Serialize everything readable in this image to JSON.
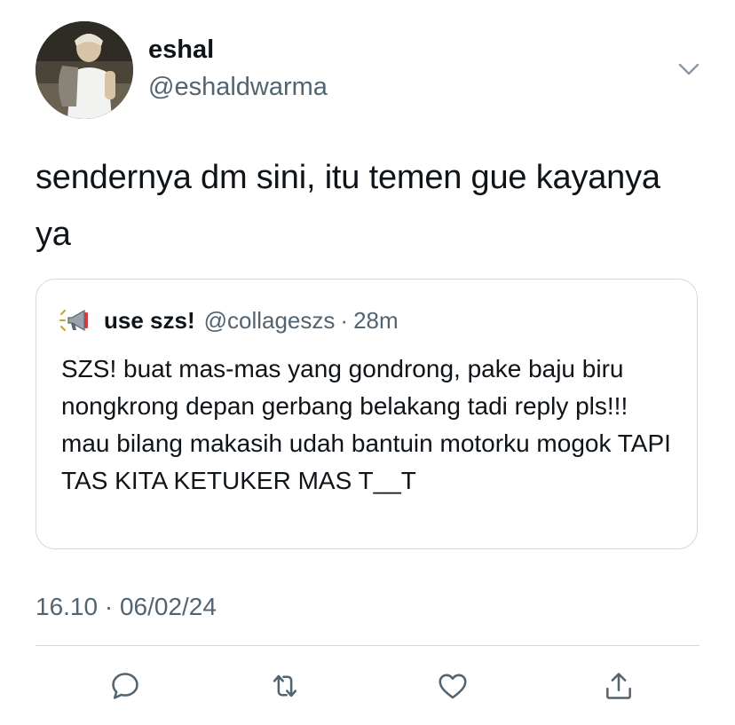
{
  "author": {
    "name": "eshal",
    "handle": "@eshaldwarma"
  },
  "tweet": {
    "text": "sendernya dm sini, itu temen gue kayanya ya",
    "timestamp": "16.10 · 06/02/24"
  },
  "quote": {
    "name": "use szs!",
    "handle": "@collageszs",
    "separator": "·",
    "time": "28m",
    "text": "SZS! buat mas-mas yang gondrong, pake baju biru nongkrong depan gerbang belakang tadi reply pls!!! mau bilang makasih udah bantuin motorku mogok TAPI TAS KITA KETUKER MAS T__T",
    "icon": "megaphone-icon"
  },
  "icons": {
    "more": "chevron-down-icon",
    "reply": "reply-icon",
    "retweet": "retweet-icon",
    "like": "heart-icon",
    "share": "share-icon"
  },
  "colors": {
    "text": "#0f1419",
    "secondary": "#536471",
    "border": "#cfd9de"
  }
}
